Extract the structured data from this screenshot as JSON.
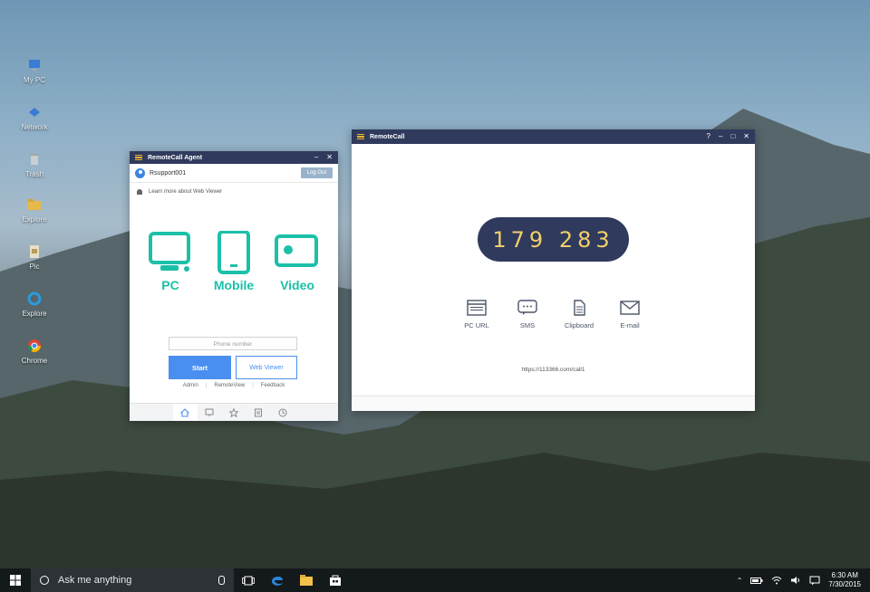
{
  "desktop": {
    "icons": [
      {
        "label": "My PC",
        "icon": "computer-icon"
      },
      {
        "label": "Network",
        "icon": "network-icon"
      },
      {
        "label": "Trash",
        "icon": "trash-icon"
      },
      {
        "label": "Explore",
        "icon": "folder-icon"
      },
      {
        "label": "Pic",
        "icon": "picture-icon"
      },
      {
        "label": "Explore",
        "icon": "ie-icon"
      },
      {
        "label": "Chrome",
        "icon": "chrome-icon"
      }
    ]
  },
  "agent_window": {
    "title": "RemoteCall Agent",
    "user": "Rsupport001",
    "logout_label": "Log Out",
    "learn_more": "Learn more about Web Viewer",
    "modes": [
      {
        "label": "PC",
        "icon": "monitor-icon"
      },
      {
        "label": "Mobile",
        "icon": "mobile-icon"
      },
      {
        "label": "Video",
        "icon": "video-icon"
      }
    ],
    "phone_placeholder": "Phone number",
    "start_label": "Start",
    "web_viewer_label": "Web Viewer",
    "links": [
      "Admin",
      "RemoteView",
      "Feedback"
    ],
    "tabs": [
      "home-icon",
      "screen-icon",
      "star-icon",
      "notes-icon",
      "history-icon"
    ],
    "accent": "#1cc0a8"
  },
  "remotecall_window": {
    "title": "RemoteCall",
    "code": "179 283",
    "share_options": [
      {
        "label": "PC URL",
        "icon": "browser-icon"
      },
      {
        "label": "SMS",
        "icon": "chat-icon"
      },
      {
        "label": "Clipboard",
        "icon": "document-icon"
      },
      {
        "label": "E-mail",
        "icon": "mail-icon"
      }
    ],
    "url": "https://113366.com/call1",
    "title_color": "#2f3a5c",
    "code_color": "#f1cf6c"
  },
  "taskbar": {
    "search_placeholder": "Ask me anything",
    "time": "6:30 AM",
    "date": "7/30/2015"
  }
}
